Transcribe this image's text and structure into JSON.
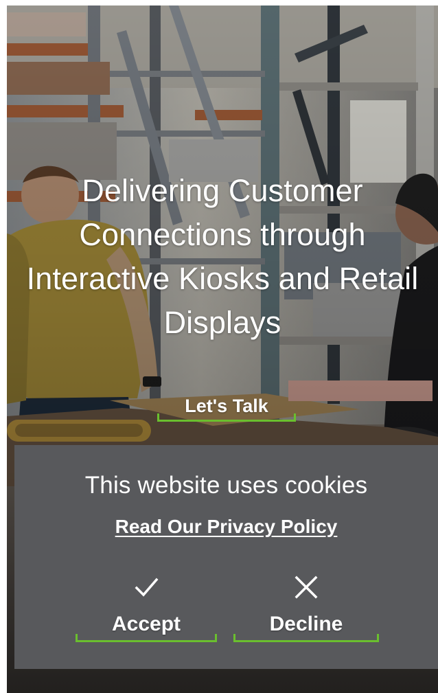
{
  "hero": {
    "headline": "Delivering Customer Connections through Interactive Kiosks and Retail Displays",
    "cta_label": "Let's Talk"
  },
  "cookie_banner": {
    "title": "This website uses cookies",
    "privacy_link": "Read Our Privacy Policy",
    "accept": {
      "icon": "checkmark-icon",
      "label": "Accept"
    },
    "decline": {
      "icon": "close-icon",
      "label": "Decline"
    }
  },
  "colors": {
    "accent": "#6abf2e",
    "banner_background": "#58595c",
    "text": "#ffffff"
  }
}
